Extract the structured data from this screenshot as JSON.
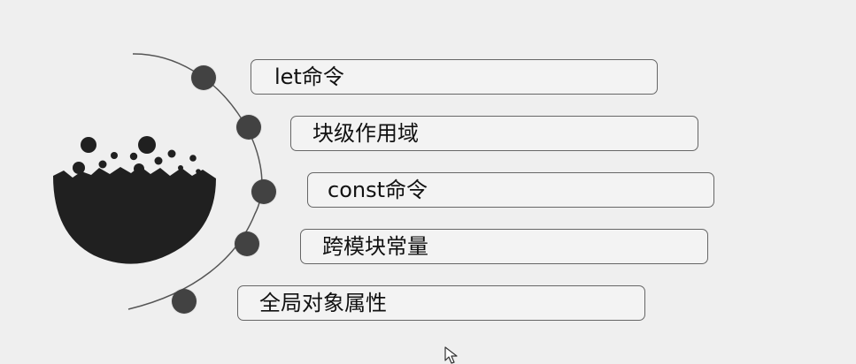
{
  "diagram": {
    "items": [
      {
        "label": "let命令"
      },
      {
        "label": "块级作用域"
      },
      {
        "label": "const命令"
      },
      {
        "label": "跨模块常量"
      },
      {
        "label": "全局对象属性"
      }
    ]
  },
  "icons": {
    "left_graphic": "bowl-with-splashes-icon",
    "cursor": "mouse-pointer-icon"
  },
  "colors": {
    "background": "#efefef",
    "box_border": "#666666",
    "dot": "#424242",
    "bowl": "#202020",
    "curve": "#555555"
  }
}
